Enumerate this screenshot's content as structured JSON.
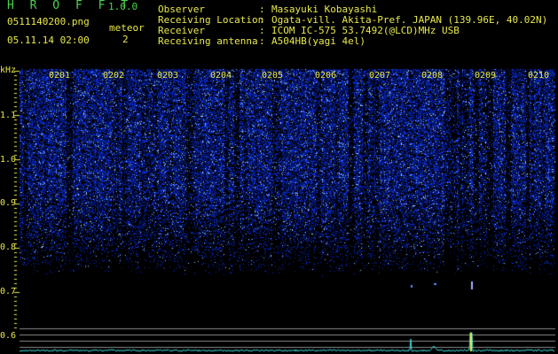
{
  "header": {
    "app_title": "H R O F F T",
    "version": "1.0.0",
    "filename": "0511140200.png",
    "meteor_label": "meteor",
    "meteor_count": "2",
    "timestamp": "05.11.14 02:00"
  },
  "info": [
    {
      "key": "Observer",
      "value": "Masayuki Kobayashi"
    },
    {
      "key": "Receiving Location",
      "value": "Ogata-vill. Akita-Pref. JAPAN (139.96E, 40.02N)"
    },
    {
      "key": "Receiver",
      "value": "ICOM IC-575 53.7492(@LCD)MHz USB"
    },
    {
      "key": "Receiving antenna",
      "value": "A504HB(yagi 4el)"
    }
  ],
  "axis": {
    "y_unit": "kHz",
    "y_ticks": [
      "1.1",
      "1.0",
      "0.9",
      "0.8",
      "0.7",
      "0.6"
    ],
    "x_ticks": [
      "0201",
      "0202",
      "0203",
      "0204",
      "0205",
      "0206",
      "0207",
      "0208",
      "0209",
      "0210"
    ]
  },
  "colors": {
    "background": "#000000",
    "noise": "#2a3cff",
    "label": "#e8e84a",
    "title": "#4cd44c",
    "trace": "#3fe0e0",
    "gridline": "#8a8a8a"
  }
}
